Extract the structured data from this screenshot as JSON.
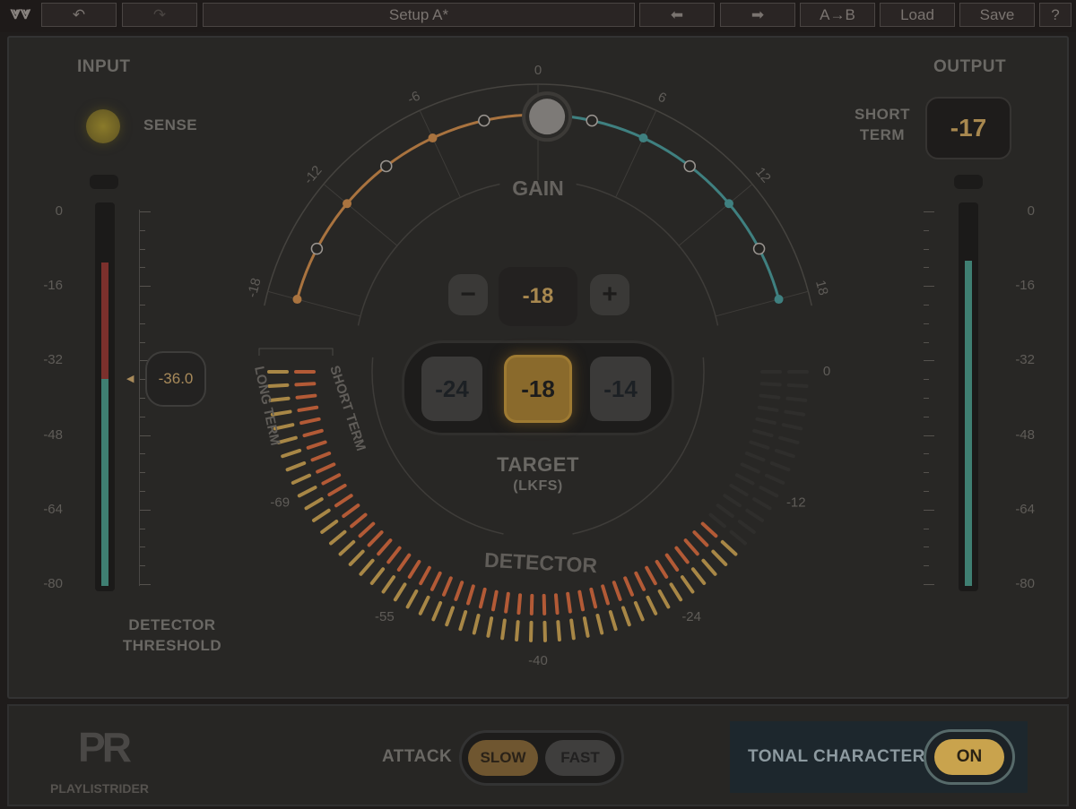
{
  "toolbar": {
    "logo": "waves-logo",
    "undo": "undo-icon",
    "redo": "redo-icon",
    "preset_name": "Setup A*",
    "prev": "arrow-left-icon",
    "next": "arrow-right-icon",
    "ab": "A→B",
    "load": "Load",
    "save": "Save",
    "help": "?"
  },
  "input": {
    "title": "INPUT",
    "sense_label": "SENSE",
    "scale": [
      "0",
      "-16",
      "-32",
      "-48",
      "-64",
      "-80"
    ],
    "level_db": -11,
    "threshold_value": "-36.0",
    "threshold_db": -36,
    "threshold_label_1": "DETECTOR",
    "threshold_label_2": "THRESHOLD"
  },
  "output": {
    "title": "OUTPUT",
    "short_term_label_1": "SHORT",
    "short_term_label_2": "TERM",
    "short_term_value": "-17",
    "scale": [
      "0",
      "-16",
      "-32",
      "-48",
      "-64",
      "-80"
    ],
    "level_db": -10.5
  },
  "gain": {
    "label": "GAIN",
    "ticks": [
      "-18",
      "-12",
      "-6",
      "0",
      "6",
      "12",
      "18"
    ],
    "value_db": 0.5,
    "colors": {
      "negative": "#a9733f",
      "positive": "#3f8080"
    }
  },
  "target": {
    "value": "-18",
    "minus": "−",
    "plus": "+",
    "presets": [
      "-24",
      "-18",
      "-14"
    ],
    "selected": "-18",
    "label": "TARGET",
    "unit": "(LKFS)"
  },
  "detector": {
    "label": "DETECTOR",
    "long_term_label": "LONG TERM",
    "short_term_label": "SHORT TERM",
    "scale": [
      "-69",
      "-55",
      "-40",
      "-24",
      "-12",
      "0"
    ],
    "short_term_db": -18,
    "long_term_db": -17.5,
    "colors": {
      "short": "#b35a36",
      "long": "#a88746"
    }
  },
  "bottom": {
    "logo_text": "PLAYLISTRIDER",
    "attack_label": "ATTACK",
    "attack_options": [
      "SLOW",
      "FAST"
    ],
    "attack_selected": "SLOW",
    "tonal_label": "TONAL CHARACTER",
    "tonal_state": "ON"
  }
}
